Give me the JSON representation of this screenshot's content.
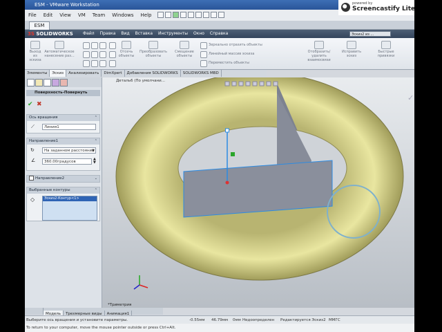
{
  "vmware": {
    "title": "ESM - VMware Workstation",
    "menu": [
      "File",
      "Edit",
      "View",
      "VM",
      "Team",
      "Windows",
      "Help"
    ],
    "tab": "ESM"
  },
  "watermark": {
    "line1": "powered by",
    "line2": "Screencastify Lite"
  },
  "solidworks": {
    "logo_ds": "3S",
    "logo_text": "SOLIDWORKS",
    "menu": [
      "Файл",
      "Правка",
      "Вид",
      "Вставка",
      "Инструменты",
      "Окно",
      "Справка"
    ],
    "doc_title": "Эскиз2 из ..."
  },
  "command_manager": {
    "buttons": [
      {
        "label": "Выход из эскиза"
      },
      {
        "label": "Автоматическое нанесение раз..."
      },
      {
        "label": "Отсечь объекты"
      },
      {
        "label": "Преобразовать объекты"
      },
      {
        "label": "Смещение объекты"
      },
      {
        "label": "Отобразить/удалить взаимосвязи"
      },
      {
        "label": "Исправить эскиз"
      },
      {
        "label": "Быстрые привязки"
      }
    ],
    "row_items": [
      "Зеркально отразить объекты",
      "Линейный массив эскиза",
      "Переместить объекты"
    ],
    "tabs": [
      "Элементы",
      "Эскиз",
      "Анализировать",
      "DimXpert",
      "Добавления SOLIDWORKS",
      "SOLIDWORKS MBD"
    ],
    "active_tab": "Эскиз"
  },
  "property_manager": {
    "title": "Поверхность-Повернуть",
    "axis_group": "Ось вращения",
    "axis_value": "Линия1",
    "direction1_group": "Направление1",
    "direction1_type": "На заданном расстоянии",
    "direction1_angle": "360.00градусов",
    "direction2_group": "Направление2",
    "contours_group": "Выбранные контуры",
    "contours_items": [
      "Эскиз2-Контур<1>"
    ]
  },
  "viewport": {
    "breadcrumb": "Деталь6 (По умолчани...",
    "view_label": "*Триметрия",
    "torus_color": "#e9e6a0",
    "plane_color": "#8a8f9c",
    "axis_color": "#2b8be3"
  },
  "bottom_tabs": [
    "Модель",
    "Трехмерные виды",
    "Анимация1"
  ],
  "status": {
    "left": "Выберите ось вращения и установите параметры.",
    "x": "-0.55мм",
    "y": "46.79мм",
    "z": "0мм",
    "state": "Недоопределен",
    "editing": "Редактируется Эскиз2",
    "units": "ММГС"
  },
  "hint": "To return to your computer, move the mouse pointer outside or press Ctrl+Alt."
}
